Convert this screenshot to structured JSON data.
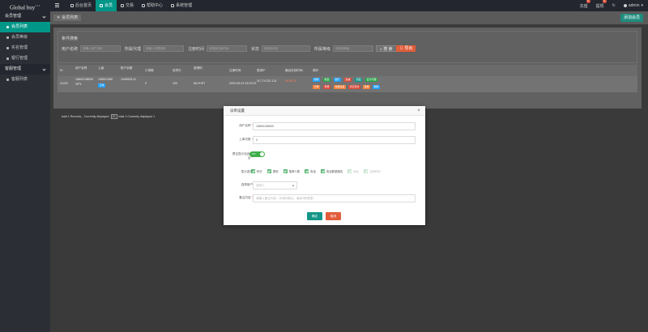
{
  "brand": {
    "name": "Global buy",
    "version": "V4.0"
  },
  "nav": [
    {
      "label": "后台首页",
      "icon": "home-icon"
    },
    {
      "label": "会员",
      "icon": "user-icon",
      "active": true
    },
    {
      "label": "交易",
      "icon": "cart-icon"
    },
    {
      "label": "帮助中心",
      "icon": "flag-icon"
    },
    {
      "label": "系统管理",
      "icon": "settings-icon"
    }
  ],
  "tools": {
    "notify_label": "充值",
    "notify_count": "0",
    "withdraw_label": "提现",
    "withdraw_count": "0",
    "user_label": "admin"
  },
  "sidebar": {
    "group1": "会员管理",
    "items1": [
      "会员列表",
      "会员等级",
      "实名管理",
      "银行管理"
    ],
    "group2": "客服管理",
    "items2": [
      "客服列表"
    ]
  },
  "tab": {
    "label": "会员列表"
  },
  "add_button": "添加会员",
  "search": {
    "title": "条件搜索",
    "fields": [
      {
        "label": "用户名称",
        "placeholder": "请输入用户名称"
      },
      {
        "label": "所属代理",
        "placeholder": "请输入代理名称"
      },
      {
        "label": "注册时间",
        "placeholder": "请选择注册时间"
      },
      {
        "label": "状态",
        "placeholder": "请选择状态"
      },
      {
        "label": "所属等级",
        "placeholder": "请选择等级"
      }
    ],
    "search_label": "搜 索",
    "export_label": "导出"
  },
  "table": {
    "headers": [
      "ID",
      "用户名称",
      "上级",
      "账户余额",
      "订单数",
      "信誉分",
      "邀请码",
      "注册时间",
      "登录IP",
      "最后在线时间",
      "操作"
    ],
    "row": {
      "id": "11203",
      "username": "15800138000",
      "parent": "138001380",
      "balance": "1445525.21",
      "orders": "0",
      "credit": "100",
      "code": "MLYHST",
      "reg_time": "2022-05-23 19:23:22",
      "ip": "117.74.221.121",
      "last_online": "06:36:29",
      "tag": "VIP1",
      "status": "正常"
    },
    "actions": [
      "编辑",
      "帐变",
      "银行",
      "加减",
      "冻结",
      "设为代理",
      "订单",
      "登录",
      "派单设置",
      "清空流水",
      "连单",
      "一键派单",
      "删除"
    ]
  },
  "pager": {
    "text1": "total 1 Records，Currently displayed",
    "page_size": "20",
    "text2": "total 1 Currently displayed 1"
  },
  "modal": {
    "title": "派单设置",
    "username_label": "用户名称",
    "username_value": "15800138000",
    "count_label": "上单次数",
    "count_value": "0",
    "switch_label": "是否显示包含项目",
    "switch_state": "ON",
    "checks_label": "显示选项",
    "checks": [
      {
        "label": "积分",
        "on": true
      },
      {
        "label": "提现",
        "on": true
      },
      {
        "label": "推荐人数",
        "on": true
      },
      {
        "label": "电话",
        "on": true
      },
      {
        "label": "电话数据报告",
        "on": true
      },
      {
        "label": "地址",
        "on": false
      },
      {
        "label": "注册时间",
        "on": false
      }
    ],
    "user_select_label": "选择用户",
    "user_select_placeholder": "选择人",
    "remark_label": "备注内容",
    "remark_placeholder": "请输入备注内容（不填写默认，最多5种类型）",
    "confirm": "确定",
    "cancel": "取消"
  }
}
